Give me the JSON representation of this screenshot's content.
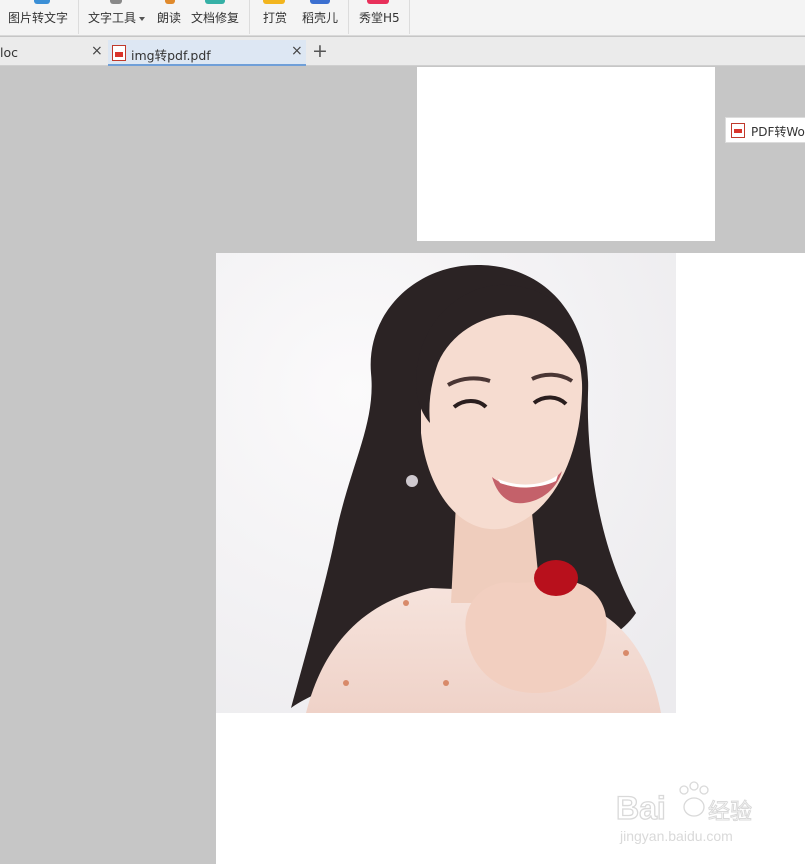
{
  "toolbar": {
    "items": [
      {
        "label": "图片转文字",
        "icon": "image-to-text-icon",
        "color": "#3b8fd6"
      },
      {
        "label": "文字工具",
        "icon": "text-tools-icon",
        "color": "#888888"
      },
      {
        "label": "朗读",
        "icon": "read-aloud-icon",
        "color": "#e08a2c"
      },
      {
        "label": "文档修复",
        "icon": "doc-repair-icon",
        "color": "#35b0a6"
      },
      {
        "label": "打赏",
        "icon": "reward-icon",
        "color": "#f2b51e"
      },
      {
        "label": "稻壳儿",
        "icon": "docer-icon",
        "color": "#3b6fd0"
      },
      {
        "label": "秀堂H5",
        "icon": "xiutang-icon",
        "color": "#e8305a"
      }
    ]
  },
  "tabs": [
    {
      "label": "loc",
      "active": false,
      "close": "×"
    },
    {
      "label": "img转pdf.pdf",
      "active": true,
      "close": "×",
      "icon": "pdf-file-icon"
    }
  ],
  "new_tab": "+",
  "side_panel": {
    "pdf_to_word_label": "PDF转Wo",
    "icon": "pdf-file-icon"
  },
  "watermark": {
    "brand": "Bai",
    "brand_cn": "经验",
    "url": "jingyan.baidu.com"
  },
  "colors": {
    "canvas": "#c6c6c6",
    "active_tab": "#dde7f3",
    "active_tab_border": "#6f9fd8"
  }
}
